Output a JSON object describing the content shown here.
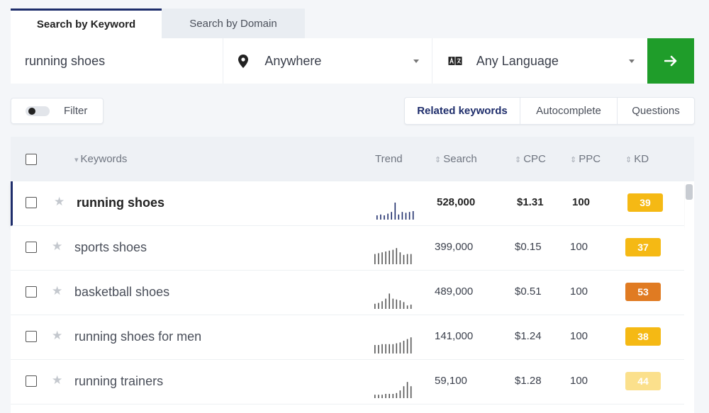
{
  "tabs": [
    {
      "label": "Search by Keyword",
      "active": true
    },
    {
      "label": "Search by Domain",
      "active": false
    }
  ],
  "search": {
    "keyword_value": "running shoes",
    "location": "Anywhere",
    "language": "Any Language",
    "go_icon": "arrow-right-icon"
  },
  "filter": {
    "label": "Filter",
    "enabled": false
  },
  "segments": [
    {
      "label": "Related keywords",
      "active": true
    },
    {
      "label": "Autocomplete",
      "active": false
    },
    {
      "label": "Questions",
      "active": false
    }
  ],
  "table": {
    "columns": {
      "keywords": "Keywords",
      "trend": "Trend",
      "search": "Search",
      "cpc": "CPC",
      "ppc": "PPC",
      "kd": "KD"
    },
    "rows": [
      {
        "keyword": "running shoes",
        "search": "528,000",
        "cpc": "$1.31",
        "ppc": "100",
        "kd": "39",
        "kd_color": "#f5b914",
        "selected": true,
        "trend": [
          0.25,
          0.3,
          0.25,
          0.35,
          0.45,
          1.0,
          0.3,
          0.45,
          0.4,
          0.45,
          0.5
        ]
      },
      {
        "keyword": "sports shoes",
        "search": "399,000",
        "cpc": "$0.15",
        "ppc": "100",
        "kd": "37",
        "kd_color": "#f5b914",
        "selected": false,
        "trend": [
          0.6,
          0.65,
          0.7,
          0.75,
          0.8,
          0.85,
          0.95,
          0.7,
          0.55,
          0.6,
          0.6
        ]
      },
      {
        "keyword": "basketball shoes",
        "search": "489,000",
        "cpc": "$0.51",
        "ppc": "100",
        "kd": "53",
        "kd_color": "#e07b22",
        "selected": false,
        "trend": [
          0.3,
          0.35,
          0.45,
          0.6,
          0.9,
          0.6,
          0.55,
          0.5,
          0.4,
          0.2,
          0.25
        ]
      },
      {
        "keyword": "running shoes for men",
        "search": "141,000",
        "cpc": "$1.24",
        "ppc": "100",
        "kd": "38",
        "kd_color": "#f5b914",
        "selected": false,
        "trend": [
          0.5,
          0.5,
          0.55,
          0.55,
          0.55,
          0.55,
          0.6,
          0.65,
          0.75,
          0.85,
          0.95
        ]
      },
      {
        "keyword": "running trainers",
        "search": "59,100",
        "cpc": "$1.28",
        "ppc": "100",
        "kd": "44",
        "kd_color": "#fbe08c",
        "selected": false,
        "trend": [
          0.2,
          0.2,
          0.2,
          0.25,
          0.25,
          0.25,
          0.3,
          0.45,
          0.7,
          0.95,
          0.7
        ]
      }
    ]
  }
}
